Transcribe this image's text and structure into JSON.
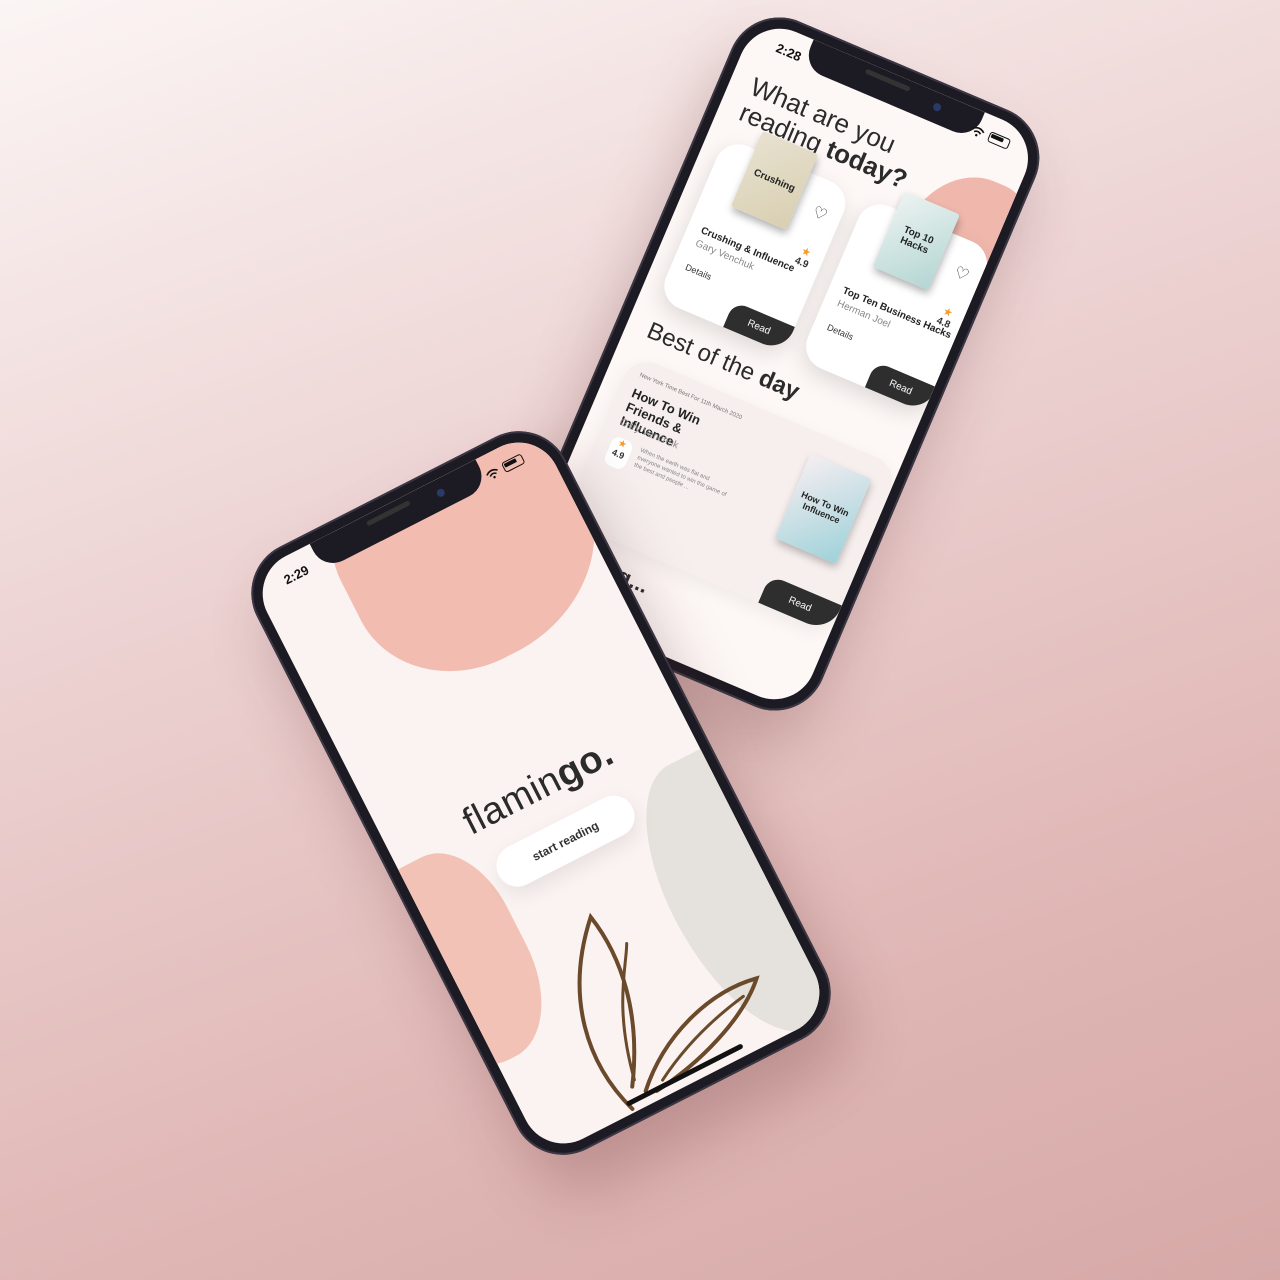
{
  "back_phone": {
    "status_time": "2:28",
    "greeting_line1": "What are you",
    "greeting_line2_light": "reading ",
    "greeting_line2_bold": "today?",
    "cards": [
      {
        "cover_text": "Crushing",
        "title": "Crushing & Influence",
        "author": "Gary Venchuk",
        "rating": "4.9",
        "details": "Details",
        "read": "Read"
      },
      {
        "cover_text": "Top 10 Hacks",
        "title": "Top Ten Business Hacks",
        "author": "Herman Joel",
        "rating": "4.8",
        "details": "Details",
        "read": "Read"
      }
    ],
    "best_light": "Best of the ",
    "best_bold": "day",
    "best_card": {
      "kicker": "New York Time Best For 11th March 2020",
      "title": "How To Win Friends & Influence",
      "author": "Gary Venchuk",
      "rating": "4.9",
      "description": "When the earth was flat and everyone wanted to win the game of the best and people ...",
      "cover_text": "How To Win Influence",
      "read": "Read"
    },
    "continue_label": "reading..."
  },
  "front_phone": {
    "status_time": "2:29",
    "brand_light": "flamin",
    "brand_bold": "go.",
    "start_button": "start reading"
  },
  "icons": {
    "heart": "heart-icon",
    "star": "star-icon",
    "wifi": "wifi-icon",
    "battery": "battery-icon"
  },
  "colors": {
    "accent_blob": "#f2b8ac",
    "button_dark": "#2e2e2e",
    "star": "#f59a2c"
  }
}
